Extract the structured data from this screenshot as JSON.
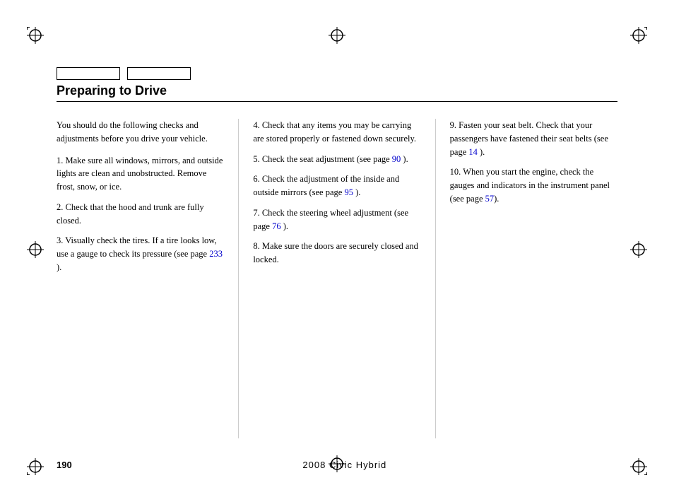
{
  "page": {
    "title": "Preparing to Drive",
    "footer": {
      "page_number": "190",
      "center_text": "2008  Civic  Hybrid"
    },
    "tabs": [
      {
        "label": ""
      },
      {
        "label": ""
      }
    ]
  },
  "columns": {
    "col1": {
      "intro": "You should do the following checks and adjustments before you drive your vehicle.",
      "items": [
        {
          "num": "1.",
          "text": "Make sure all windows, mirrors, and outside lights are clean and unobstructed. Remove frost, snow, or ice."
        },
        {
          "num": "2.",
          "text": "Check that the hood and trunk are fully closed."
        },
        {
          "num": "3.",
          "text": "Visually check the tires. If a tire looks low, use a gauge to check its pressure (see page ",
          "link_text": "233",
          "text_after": " )."
        }
      ]
    },
    "col2": {
      "items": [
        {
          "num": "4.",
          "text": "Check that any items you may be carrying are stored properly or fastened down securely."
        },
        {
          "num": "5.",
          "text": "Check the seat adjustment (see page ",
          "link_text": "90",
          "text_after": " )."
        },
        {
          "num": "6.",
          "text": "Check the adjustment of the inside and outside mirrors (see page ",
          "link_text": "95",
          "text_after": " )."
        },
        {
          "num": "7.",
          "text": "Check the steering wheel adjustment (see page ",
          "link_text": "76",
          "text_after": "  )."
        },
        {
          "num": "8.",
          "text": "Make sure the doors are securely closed and locked."
        }
      ]
    },
    "col3": {
      "items": [
        {
          "num": "9.",
          "text": "Fasten your seat belt. Check that your passengers have fastened their seat belts (see page ",
          "link_text": "14",
          "text_after": " )."
        },
        {
          "num": "10.",
          "text": "When you start the engine, check the gauges and indicators in the instrument panel (see page ",
          "link_text": "57",
          "text_after": ")."
        }
      ]
    }
  },
  "icons": {
    "crosshair": "⊕",
    "corner_tl": "corner-tl",
    "corner_tr": "corner-tr",
    "corner_bl": "corner-bl",
    "corner_br": "corner-br"
  }
}
